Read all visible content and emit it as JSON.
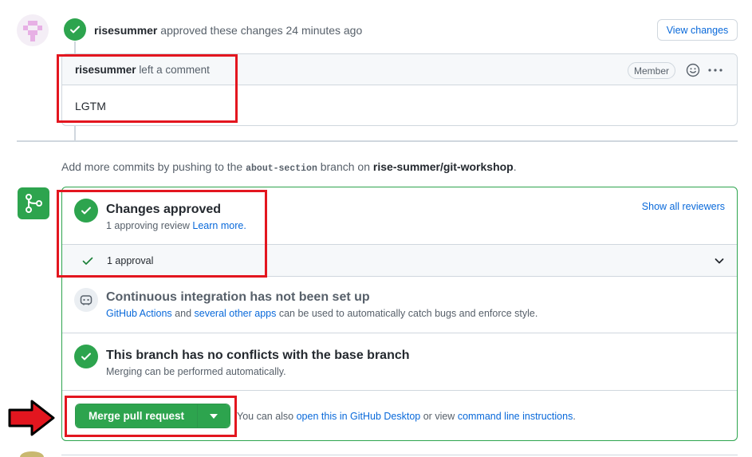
{
  "review_event": {
    "author": "risesummer",
    "action_text": "approved these changes 24 minutes ago",
    "view_changes_label": "View changes"
  },
  "comment": {
    "author": "risesummer",
    "action_text": "left a comment",
    "badge": "Member",
    "body": "LGTM"
  },
  "push_info": {
    "prefix": "Add more commits by pushing to the",
    "branch": "about-section",
    "middle": "branch on",
    "repo": "rise-summer/git-workshop",
    "suffix": "."
  },
  "merge_box": {
    "approved": {
      "title": "Changes approved",
      "sub_prefix": "1 approving review",
      "learn_more": "Learn more.",
      "show_reviewers": "Show all reviewers"
    },
    "approval_row": {
      "label": "1 approval"
    },
    "ci": {
      "title": "Continuous integration has not been set up",
      "actions_link": "GitHub Actions",
      "and_text": "and",
      "other_apps_link": "several other apps",
      "rest_text": "can be used to automatically catch bugs and enforce style."
    },
    "conflicts": {
      "title": "This branch has no conflicts with the base branch",
      "sub": "Merging can be performed automatically."
    },
    "merge": {
      "button_label": "Merge pull request",
      "hint_prefix": "You can also",
      "desktop_link": "open this in GitHub Desktop",
      "hint_middle": "or view",
      "cli_link": "command line instructions",
      "hint_suffix": "."
    }
  },
  "colors": {
    "success": "#2da44e",
    "link": "#0969da",
    "annotation_red": "#e3161f"
  },
  "icons": [
    "check-icon",
    "smiley-icon",
    "kebab-icon",
    "git-merge-icon",
    "chevron-down-icon",
    "ci-robot-icon",
    "caret-down-icon",
    "red-arrow-icon"
  ]
}
